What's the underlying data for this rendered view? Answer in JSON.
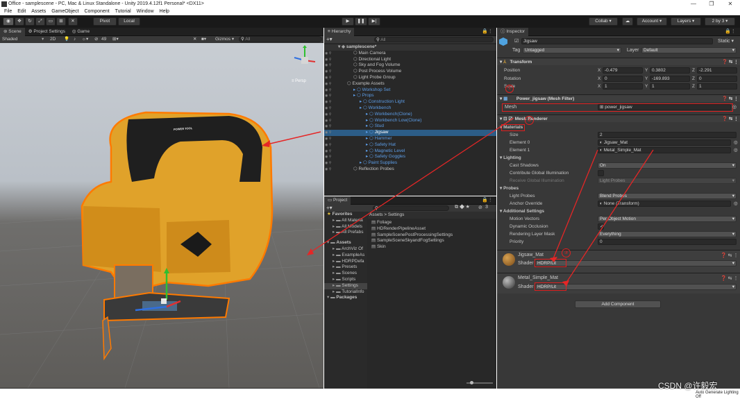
{
  "window": {
    "title": "Office - samplescene - PC, Mac & Linux Standalone - Unity 2019.4.12f1 Personal* <DX11>",
    "controls": [
      "—",
      "❐",
      "✕"
    ]
  },
  "menu": [
    "File",
    "Edit",
    "Assets",
    "GameObject",
    "Component",
    "Tutorial",
    "Window",
    "Help"
  ],
  "toolbar": {
    "pivot": "Pivot",
    "local": "Local",
    "collab": "Collab ▾",
    "account": "Account ▾",
    "layers": "Layers ▾",
    "layout": "2 by 3 ▾"
  },
  "scene": {
    "tabs": [
      "Scene",
      "Project Settings",
      "Game"
    ],
    "shading": "Shaded",
    "mode2d": "2D",
    "gizmos": "Gizmos ▾",
    "search": "All",
    "hidden_count": "49",
    "persp": "≡ Persp",
    "brand": "POWER TOOL"
  },
  "hierarchy": {
    "tab": "Hierarchy",
    "search": "All",
    "rows": [
      {
        "label": "samplescene*",
        "indent": 0,
        "style": "root"
      },
      {
        "label": "Main Camera",
        "indent": 2,
        "style": ""
      },
      {
        "label": "Directional Light",
        "indent": 2,
        "style": ""
      },
      {
        "label": "Sky and Fog Volume",
        "indent": 2,
        "style": ""
      },
      {
        "label": "Post Process Volume",
        "indent": 2,
        "style": ""
      },
      {
        "label": "Light Probe Group",
        "indent": 2,
        "style": ""
      },
      {
        "label": "Example Assets",
        "indent": 1,
        "style": ""
      },
      {
        "label": "Workshop Set",
        "indent": 2,
        "style": "blue"
      },
      {
        "label": "Props",
        "indent": 2,
        "style": "blue"
      },
      {
        "label": "Construction Light",
        "indent": 3,
        "style": "blue"
      },
      {
        "label": "Workbench",
        "indent": 3,
        "style": "blue"
      },
      {
        "label": "Workbench(Clone)",
        "indent": 4,
        "style": "blue"
      },
      {
        "label": "Workbench Low(Clone)",
        "indent": 4,
        "style": "blue"
      },
      {
        "label": "Stud",
        "indent": 4,
        "style": "blue"
      },
      {
        "label": "Jigsaw",
        "indent": 4,
        "style": "sel"
      },
      {
        "label": "Hammer",
        "indent": 4,
        "style": "blue"
      },
      {
        "label": "Safety Hat",
        "indent": 4,
        "style": "blue"
      },
      {
        "label": "Magnetic Level",
        "indent": 4,
        "style": "blue"
      },
      {
        "label": "Safety Goggles",
        "indent": 4,
        "style": "blue"
      },
      {
        "label": "Paint Supplies",
        "indent": 3,
        "style": "blue"
      },
      {
        "label": "Reflection Probes",
        "indent": 2,
        "style": ""
      }
    ]
  },
  "project": {
    "tab": "Project",
    "count": "3",
    "breadcrumb": "Assets > Settings",
    "favorites": [
      "Favorites",
      "All Materia",
      "All Models",
      "All Prefabs"
    ],
    "assets": [
      "Assets",
      "ArchViz Of",
      "ExampleAs",
      "HDRPDefa",
      "Presets",
      "Scenes",
      "Scripts",
      "Settings",
      "TutorialInfo",
      "Packages"
    ],
    "files": [
      "Foliage",
      "HDRenderPipelineAsset",
      "SampleScenePostProcessingSettings",
      "SampleSceneSkyandFogSettings",
      "Skin"
    ]
  },
  "inspector": {
    "tab": "Inspector",
    "name": "Jigsaw",
    "static": "Static ▾",
    "tag_label": "Tag",
    "tag": "Untagged",
    "layer_label": "Layer",
    "layer": "Default",
    "transform": {
      "title": "Transform",
      "rows": [
        {
          "label": "Position",
          "x": "-0.479",
          "y": "0.3802",
          "z": "-2.291"
        },
        {
          "label": "Rotation",
          "x": "0",
          "y": "-169.893",
          "z": "0"
        },
        {
          "label": "Scale",
          "x": "1",
          "y": "1",
          "z": "1"
        }
      ]
    },
    "meshfilter": {
      "title": "Power_jigsaw (Mesh Filter)",
      "mesh_label": "Mesh",
      "mesh": "power_jigsaw"
    },
    "renderer": {
      "title": "Mesh Renderer",
      "materials": "Materials",
      "size_label": "Size",
      "size": "2",
      "e0_label": "Element 0",
      "e0": "Jigsaw_Mat",
      "e1_label": "Element 1",
      "e1": "Metal_Simple_Mat",
      "lighting": "Lighting",
      "cast_label": "Cast Shadows",
      "cast": "On",
      "gi_label": "Contribute Global Illumination",
      "rgi_label": "Receive Global Illumination",
      "rgi": "Light Probes",
      "probes": "Probes",
      "lp_label": "Light Probes",
      "lp": "Blend Probes",
      "ao_label": "Anchor Override",
      "ao": "None (Transform)",
      "add": "Additional Settings",
      "mv_label": "Motion Vectors",
      "mv": "Per Object Motion",
      "do_label": "Dynamic Occlusion",
      "rlm_label": "Rendering Layer Mask",
      "rlm": "Everything",
      "pr_label": "Priority",
      "pr": "0"
    },
    "mat1": {
      "name": "Jigsaw_Mat",
      "shader_label": "Shader",
      "shader": "HDRP/Lit"
    },
    "mat2": {
      "name": "Metal_Simple_Mat",
      "shader_label": "Shader",
      "shader": "HDRP/Lit"
    },
    "add_component": "Add Component"
  },
  "annotations": [
    "①",
    "②",
    "③"
  ],
  "watermark": {
    "csdn": "CSDN @许毅宏",
    "status": "Auto Generate Lighting Off"
  }
}
